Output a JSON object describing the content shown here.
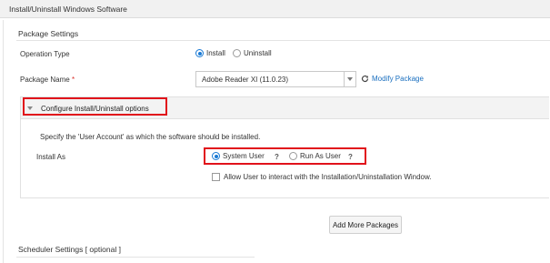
{
  "window": {
    "title": "Install/Uninstall Windows Software"
  },
  "package_settings": {
    "title": "Package Settings",
    "operation_type": {
      "label": "Operation Type",
      "options": [
        {
          "label": "Install",
          "selected": true
        },
        {
          "label": "Uninstall",
          "selected": false
        }
      ]
    },
    "package_name": {
      "label": "Package Name",
      "required_mark": "*",
      "selected_value": "Adobe Reader XI (11.0.23)",
      "modify_link": "Modify Package"
    }
  },
  "configure": {
    "title": "Configure Install/Uninstall options",
    "description": "Specify the 'User Account' as which the software should be installed.",
    "install_as": {
      "label": "Install As",
      "options": [
        {
          "label": "System User",
          "selected": true,
          "help": "?"
        },
        {
          "label": "Run As User",
          "selected": false,
          "help": "?"
        }
      ]
    },
    "allow_interact": {
      "label": "Allow User to interact with the Installation/Uninstallation Window.",
      "checked": false
    }
  },
  "add_more_button": "Add More Packages",
  "scheduler": {
    "title": "Scheduler Settings [ optional ]"
  },
  "colors": {
    "accent": "#1a7ad4",
    "highlight_box": "#e1121b",
    "link": "#1a6fbf"
  }
}
